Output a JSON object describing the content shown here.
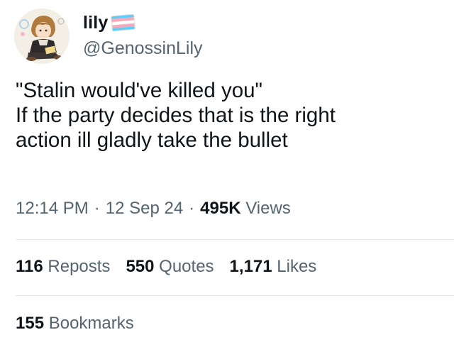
{
  "author": {
    "display_name": "lily",
    "handle": "@GenossinLily",
    "avatar_icon": "anime-character-avatar-icon",
    "flag_icon": "transgender-flag-icon",
    "flag_colors": [
      "#5bcefa",
      "#f5a9b8",
      "#ffffff",
      "#f5a9b8",
      "#5bcefa"
    ]
  },
  "tweet": {
    "lines": [
      "\"Stalin would've killed you\"",
      "If the party decides that is the right",
      "action ill gladly take the bullet"
    ]
  },
  "meta": {
    "time": "12:14 PM",
    "separator": "·",
    "date": "12 Sep 24",
    "views_count": "495K",
    "views_label": "Views"
  },
  "stats": {
    "reposts_count": "116",
    "reposts_label": "Reposts",
    "quotes_count": "550",
    "quotes_label": "Quotes",
    "likes_count": "1,171",
    "likes_label": "Likes",
    "bookmarks_count": "155",
    "bookmarks_label": "Bookmarks"
  },
  "colors": {
    "primary_text": "#0f1419",
    "secondary_text": "#536471",
    "divider": "#e4e8eb"
  }
}
